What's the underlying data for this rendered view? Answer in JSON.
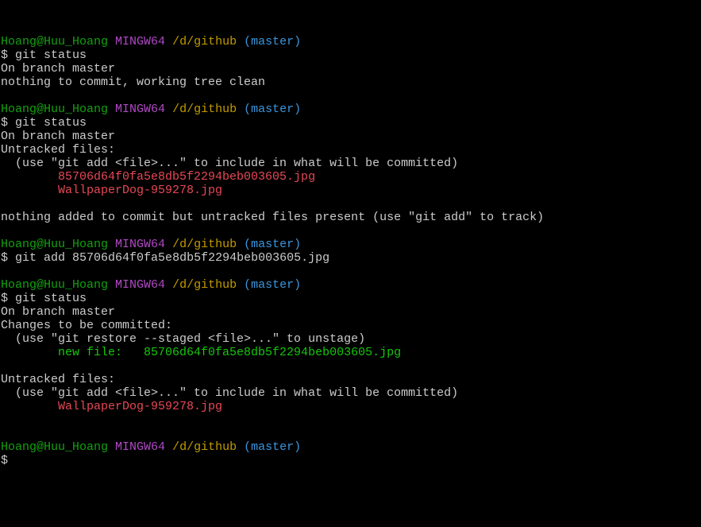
{
  "prompt": {
    "user": "Hoang@Huu_Hoang",
    "host": "MINGW64",
    "path": "/d/github",
    "branch": "(master)",
    "symbol": "$"
  },
  "colors": {
    "background": "#000000",
    "default_text": "#cccccc",
    "user": "#13a10e",
    "host": "#b148c6",
    "path": "#c19c00",
    "branch": "#3a96dd",
    "untracked": "#e74856",
    "staged": "#16c60c"
  },
  "blocks": [
    {
      "command": "git status",
      "output": [
        {
          "text": "On branch master",
          "style": "normal"
        },
        {
          "text": "nothing to commit, working tree clean",
          "style": "normal"
        }
      ]
    },
    {
      "command": "git status",
      "output": [
        {
          "text": "On branch master",
          "style": "normal"
        },
        {
          "text": "Untracked files:",
          "style": "normal"
        },
        {
          "text": "  (use \"git add <file>...\" to include in what will be committed)",
          "style": "normal"
        },
        {
          "text": "        85706d64f0fa5e8db5f2294beb003605.jpg",
          "style": "untracked"
        },
        {
          "text": "        WallpaperDog-959278.jpg",
          "style": "untracked"
        },
        {
          "text": "",
          "style": "normal"
        },
        {
          "text": "nothing added to commit but untracked files present (use \"git add\" to track)",
          "style": "normal"
        }
      ]
    },
    {
      "command": "git add 85706d64f0fa5e8db5f2294beb003605.jpg",
      "output": []
    },
    {
      "command": "git status",
      "output": [
        {
          "text": "On branch master",
          "style": "normal"
        },
        {
          "text": "Changes to be committed:",
          "style": "normal"
        },
        {
          "text": "  (use \"git restore --staged <file>...\" to unstage)",
          "style": "normal"
        },
        {
          "text": "        new file:   85706d64f0fa5e8db5f2294beb003605.jpg",
          "style": "staged"
        },
        {
          "text": "",
          "style": "normal"
        },
        {
          "text": "Untracked files:",
          "style": "normal"
        },
        {
          "text": "  (use \"git add <file>...\" to include in what will be committed)",
          "style": "normal"
        },
        {
          "text": "        WallpaperDog-959278.jpg",
          "style": "untracked"
        },
        {
          "text": "",
          "style": "normal"
        }
      ]
    }
  ],
  "final_prompt": {
    "command": ""
  }
}
